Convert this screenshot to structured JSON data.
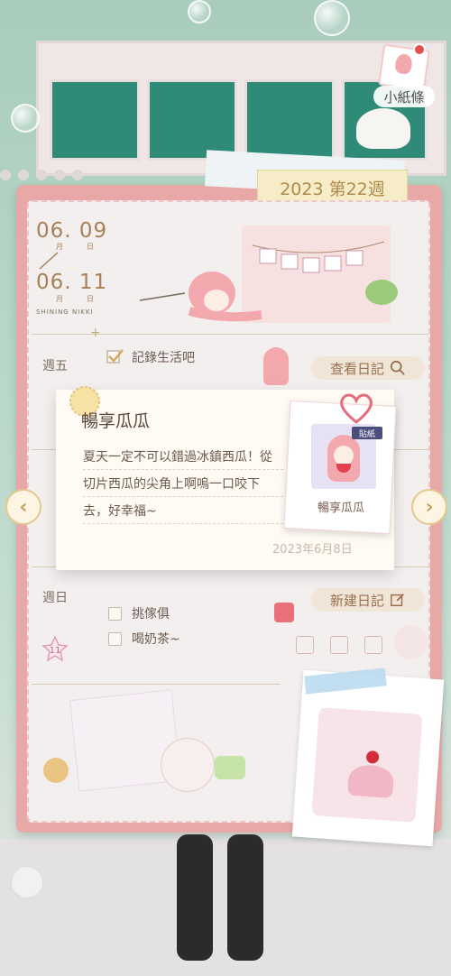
{
  "header": {
    "note_label": "小紙條"
  },
  "week": {
    "label": "2023 第22週"
  },
  "date_range": {
    "start": "06. 09",
    "end": "06. 11",
    "month_char": "月",
    "day_char": "日",
    "brand": "SHINING NIKKI"
  },
  "days": [
    {
      "label": "週五",
      "todo": "記錄生活吧",
      "action": "查看日記"
    },
    {
      "label": "週日",
      "action": "新建日記",
      "todos": [
        "挑傢俱",
        "喝奶茶~"
      ],
      "day_badge": "11"
    }
  ],
  "popup": {
    "title": "暢享瓜瓜",
    "body": "夏天一定不可以錯過冰鎮西瓜！從切片西瓜的尖角上啊嗚一口咬下去，好幸福~",
    "date": "2023年6月8日",
    "sticker_tag": "貼紙",
    "sticker_name": "暢享瓜瓜"
  },
  "colors": {
    "accent": "#e8a8a8",
    "gold": "#c79f5a",
    "text_brown": "#6e5a4c"
  },
  "icons": [
    "search-icon",
    "edit-icon",
    "heart-icon",
    "sun-icon",
    "chevron-left-icon",
    "chevron-right-icon",
    "star-icon",
    "checkmark-icon"
  ]
}
